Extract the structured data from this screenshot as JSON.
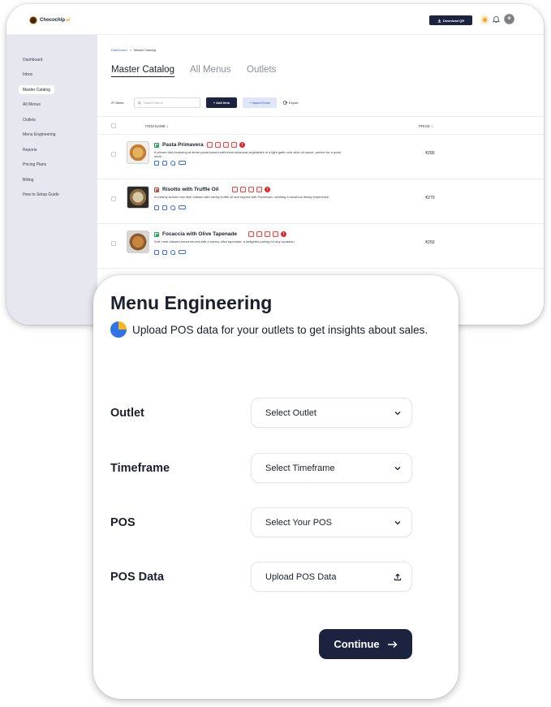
{
  "app": {
    "logo_text": "Chocochip",
    "logo_suffix": ".ai",
    "download_label": "Download QR"
  },
  "sidebar": {
    "items": [
      {
        "label": "Dashboard"
      },
      {
        "label": "Inbox"
      },
      {
        "label": "Master Catalog"
      },
      {
        "label": "All Menus"
      },
      {
        "label": "Outlets"
      },
      {
        "label": "Menu Engineering"
      },
      {
        "label": "Reports"
      },
      {
        "label": "Pricing Plans"
      },
      {
        "label": "Billing"
      },
      {
        "label": "How to Setup Guide"
      }
    ],
    "active": "Master Catalog"
  },
  "breadcrumb": {
    "root": "Dashboard",
    "separator": ">",
    "current": "Master Catalog"
  },
  "tabs": [
    {
      "label": "Master Catalog"
    },
    {
      "label": "All Menus"
    },
    {
      "label": "Outlets"
    }
  ],
  "toolbar": {
    "count": "27 Items",
    "search_placeholder": "Search Items",
    "add_label": "+ Add Item",
    "import_label": "+ Import Excel",
    "export_label": "Export"
  },
  "table": {
    "col_name": "ITEM NAME ↕",
    "col_price": "PRICE ↕",
    "rows": [
      {
        "name": "Pasta Primavera",
        "diet": "veg",
        "description": "A vibrant dish featuring al dente pasta tossed with fresh seasonal vegetables in a light garlic and olive oil sauce, perfect for a quick meal.",
        "price": "₹290"
      },
      {
        "name": "Risotto with Truffle Oil",
        "diet": "non-veg",
        "description": "A creamy Arborio rice dish infused with earthy truffle oil and topped with Parmesan, creating a luxurious dining experience.",
        "price": "₹270"
      },
      {
        "name": "Focaccia with Olive Tapenade",
        "diet": "veg",
        "description": "Soft, herb-infused bread served with a savory olive tapenade, a delightful pairing for any occasion.",
        "price": "₹250"
      }
    ]
  },
  "modal": {
    "title": "Menu Engineering",
    "subtitle": "Upload POS data for your outlets to get insights about sales.",
    "fields": [
      {
        "label": "Outlet",
        "value": "Select Outlet",
        "icon": "chevron-down-icon"
      },
      {
        "label": "Timeframe",
        "value": "Select Timeframe",
        "icon": "chevron-down-icon"
      },
      {
        "label": "POS",
        "value": "Select Your POS",
        "icon": "chevron-down-icon"
      },
      {
        "label": "POS Data",
        "value": "Upload POS Data",
        "icon": "upload-icon"
      }
    ],
    "continue_label": "Continue"
  },
  "colors": {
    "primary": "#1b2340",
    "accent": "#3a6df0",
    "sidebar_bg": "#e7e8ef",
    "veg": "#1f9d55",
    "non_veg": "#c0392b",
    "allergen": "#e64a4a"
  }
}
